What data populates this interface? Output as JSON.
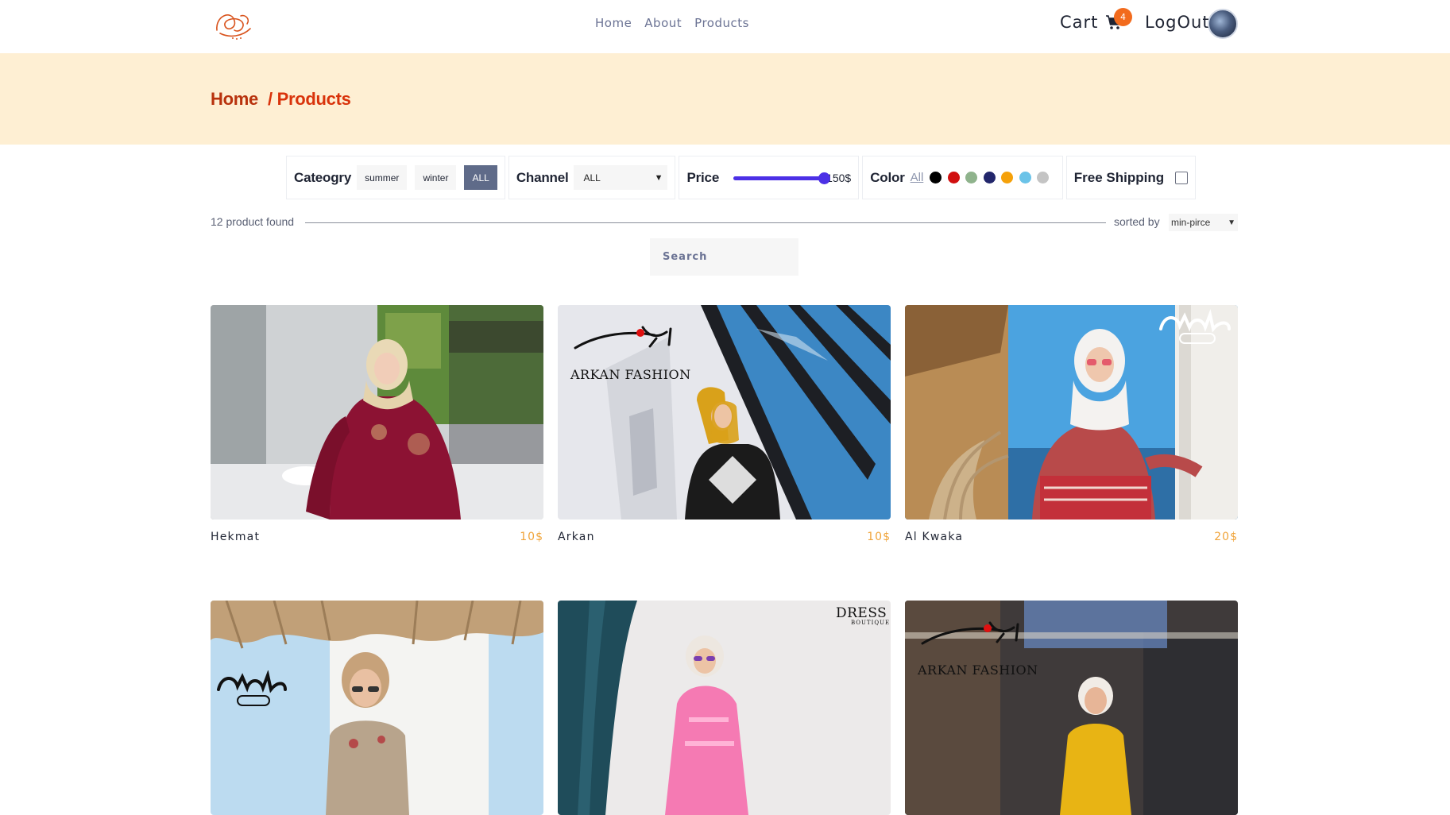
{
  "nav": {
    "home": "Home",
    "about": "About",
    "products": "Products"
  },
  "header": {
    "cart_label": "Cart",
    "cart_count": "4",
    "logout_label": "LogOut"
  },
  "breadcrumb": {
    "home": "Home",
    "current": "/ Products"
  },
  "filters": {
    "category_label": "Cateogry",
    "category_options": [
      "summer",
      "winter",
      "ALL"
    ],
    "category_selected": "ALL",
    "channel_label": "Channel",
    "channel_value": "ALL",
    "price_label": "Price",
    "price_value": "150$",
    "price_fraction": 1.0,
    "color_label": "Color",
    "color_all": "All",
    "colors": [
      "#000000",
      "#d10f0f",
      "#8fb38c",
      "#22266b",
      "#f5a10a",
      "#6bc3e8",
      "#c4c4c4"
    ],
    "free_shipping_label": "Free Shipping",
    "free_shipping_checked": false
  },
  "results": {
    "count_text": "12 product found",
    "sorted_label": "sorted by",
    "sort_value": "min-pirce"
  },
  "search": {
    "placeholder": "Search"
  },
  "products": [
    {
      "name": "Hekmat",
      "price": "10$"
    },
    {
      "name": "Arkan",
      "price": "10$"
    },
    {
      "name": "Al Kwaka",
      "price": "20$"
    },
    {
      "name": "",
      "price": ""
    },
    {
      "name": "",
      "price": ""
    },
    {
      "name": "",
      "price": ""
    }
  ],
  "brands": {
    "arkan": "ARKAN FASHION",
    "dress": "DRESS",
    "dress_sub": "BOUTIQUE"
  },
  "colors": {
    "accent": "#d9330b",
    "band": "#feefd3",
    "badge": "#f26b1d",
    "price": "#f0a43a",
    "slider": "#4c30e6"
  }
}
